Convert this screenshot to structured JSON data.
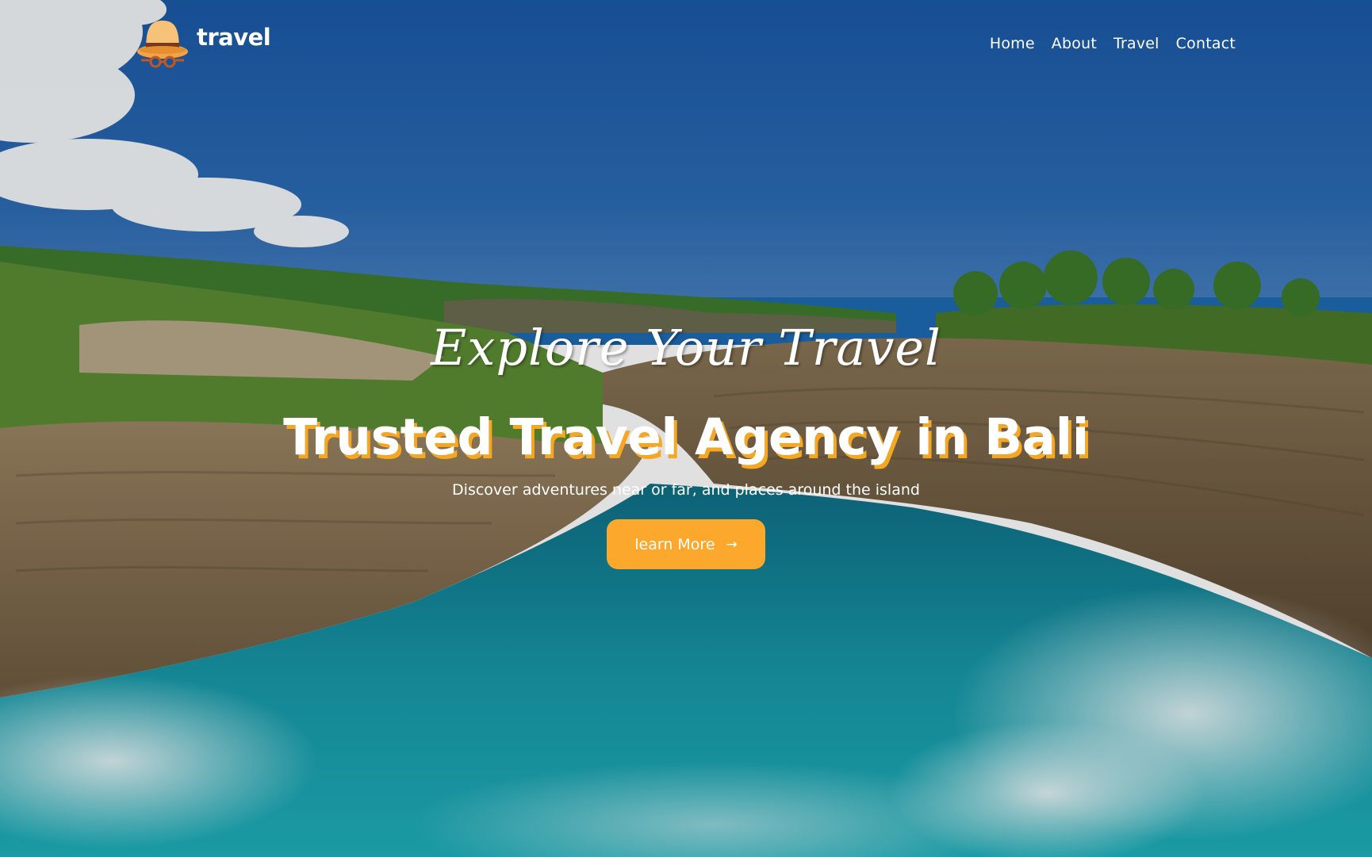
{
  "brand": {
    "name": "travel",
    "logo_icon": "hat-with-sunglasses-icon"
  },
  "nav": {
    "items": [
      {
        "label": "Home"
      },
      {
        "label": "About"
      },
      {
        "label": "Travel"
      },
      {
        "label": "Contact"
      }
    ]
  },
  "hero": {
    "script_title": "Explore Your Travel",
    "title": "Trusted Travel Agency in Bali",
    "subtitle": "Discover adventures near or far, and places around the island",
    "cta_label": "learn More",
    "cta_icon": "arrow-right-icon",
    "background_image": "coastal-cliff-arch-icon"
  },
  "colors": {
    "accent": "#fca82c",
    "title_shadow": "#f5a623",
    "sky": "#1e5fae",
    "sea": "#1aa3b0"
  }
}
